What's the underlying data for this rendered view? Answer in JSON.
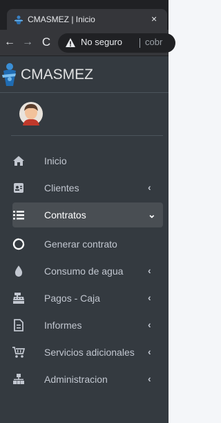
{
  "browser": {
    "tab_title": "CMASMEZ | Inicio",
    "close_glyph": "×",
    "back_glyph": "←",
    "forward_glyph": "→",
    "reload_glyph": "C",
    "security_label": "No seguro",
    "url_fragment": "cobr"
  },
  "sidebar": {
    "brand": "CMASMEZ",
    "colors": {
      "background": "#343a40",
      "active_item": "#494e53",
      "text": "#c2c7d0"
    },
    "items": [
      {
        "label": "Inicio",
        "icon": "home-icon",
        "has_arrow": false,
        "active": false
      },
      {
        "label": "Clientes",
        "icon": "address-card-icon",
        "has_arrow": true,
        "arrow": "‹",
        "active": false
      },
      {
        "label": "Contratos",
        "icon": "list-icon",
        "has_arrow": true,
        "arrow": "⌄",
        "active": true
      },
      {
        "label": "Generar contrato",
        "icon": "circle-icon",
        "has_arrow": false,
        "active": false
      },
      {
        "label": "Consumo de agua",
        "icon": "water-drop-icon",
        "has_arrow": true,
        "arrow": "‹",
        "active": false
      },
      {
        "label": "Pagos - Caja",
        "icon": "cash-register-icon",
        "has_arrow": true,
        "arrow": "‹",
        "active": false
      },
      {
        "label": "Informes",
        "icon": "document-icon",
        "has_arrow": true,
        "arrow": "‹",
        "active": false
      },
      {
        "label": "Servicios adicionales",
        "icon": "cart-icon",
        "has_arrow": true,
        "arrow": "‹",
        "active": false
      },
      {
        "label": "Administracion",
        "icon": "network-icon",
        "has_arrow": true,
        "arrow": "‹",
        "active": false
      }
    ]
  }
}
